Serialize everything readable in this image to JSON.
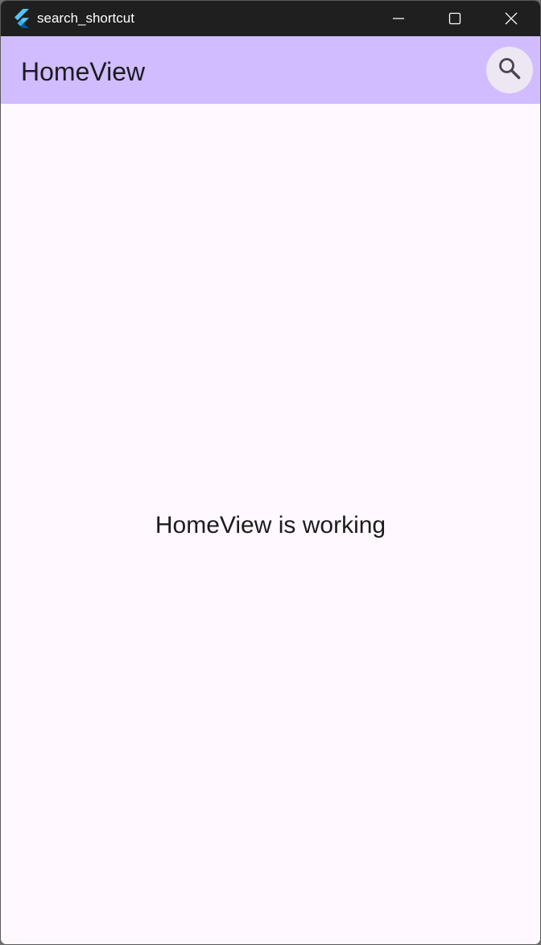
{
  "window": {
    "title": "search_shortcut",
    "controls": {
      "minimize_icon": "minimize-icon",
      "maximize_icon": "maximize-icon",
      "close_icon": "close-icon"
    }
  },
  "appbar": {
    "title": "HomeView",
    "search_icon": "search-icon"
  },
  "main": {
    "message": "HomeView is working"
  },
  "colors": {
    "titlebar": "#1f1f1f",
    "appbar": "#d0bcff",
    "search_button": "#ede6f3",
    "background": "#fff9ff",
    "text": "#1d1b20",
    "flutter_light_blue": "#54c5f8",
    "flutter_dark_blue": "#01579b"
  }
}
